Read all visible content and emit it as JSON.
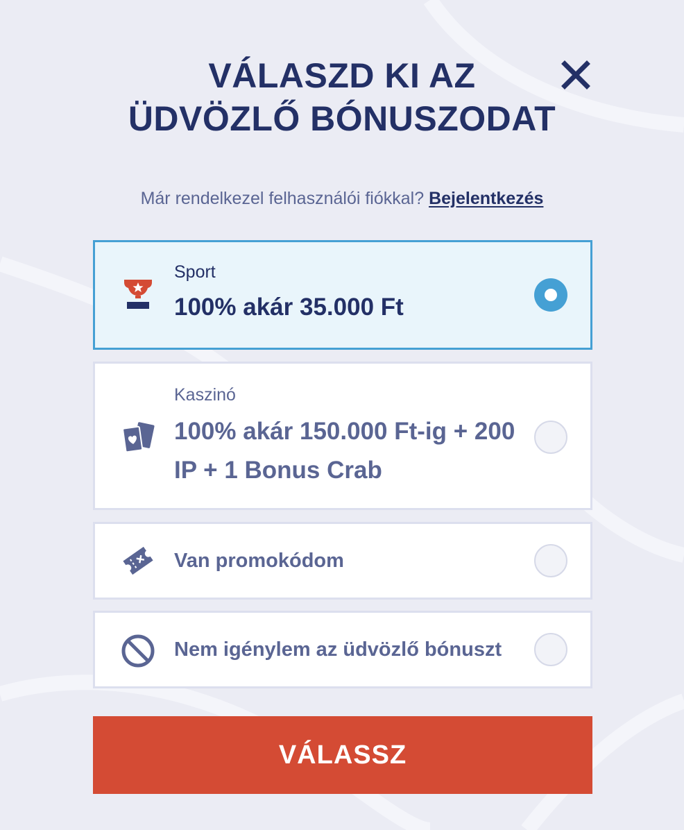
{
  "title_line1": "VÁLASZD KI AZ",
  "title_line2": "ÜDVÖZLŐ BÓNUSZODAT",
  "login": {
    "question": "Már rendelkezel felhasználói fiókkal?",
    "link": "Bejelentkezés"
  },
  "options": [
    {
      "icon": "trophy-icon",
      "category": "Sport",
      "offer": "100% akár 35.000 Ft",
      "selected": true
    },
    {
      "icon": "cards-icon",
      "category": "Kaszinó",
      "offer_line1": "100% akár 150.000 Ft-ig + 200",
      "offer_line2": "IP + 1 Bonus Crab",
      "selected": false
    },
    {
      "icon": "ticket-icon",
      "label": "Van promokódom",
      "selected": false
    },
    {
      "icon": "no-entry-icon",
      "label": "Nem igénylem az üdvözlő bónuszt",
      "selected": false
    }
  ],
  "submit_label": "VÁLASSZ",
  "colors": {
    "background": "#ebecf4",
    "navy": "#233066",
    "muted": "#5a6593",
    "accent_blue": "#45a0d4",
    "selected_bg": "#e9f5fb",
    "button_red": "#d44b34"
  }
}
